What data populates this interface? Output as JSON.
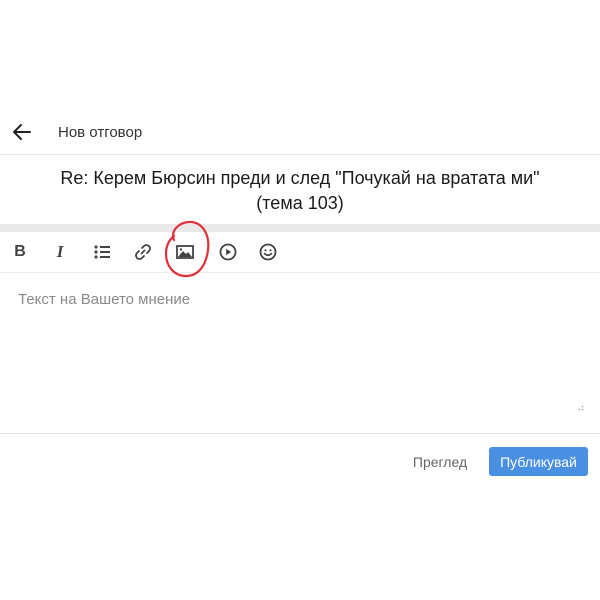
{
  "header": {
    "back_icon": "arrow-left-icon",
    "title": "Нов отговор"
  },
  "topic": {
    "line1": "Re: Керем Бюрсин преди и след \"Почукай на вратата ми\"",
    "line2": "(тема 103)"
  },
  "toolbar": {
    "bold_label": "B",
    "italic_label": "I",
    "icons": [
      "bold-icon",
      "italic-icon",
      "bulleted-list-icon",
      "link-icon",
      "image-icon",
      "video-play-icon",
      "emoji-icon"
    ]
  },
  "annotation": {
    "color": "#e0303a",
    "target": "image-icon"
  },
  "editor": {
    "placeholder": "Текст на Вашето мнение"
  },
  "actions": {
    "preview_label": "Преглед",
    "publish_label": "Публикувай",
    "publish_color": "#4a90e2"
  }
}
